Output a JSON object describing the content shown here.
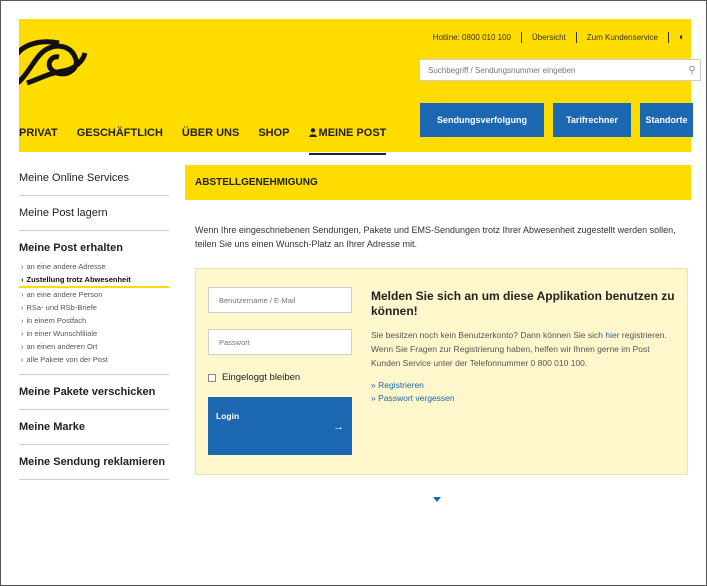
{
  "header": {
    "utility": {
      "hotline": "Hotline: 0800 010 100",
      "overview": "Übersicht",
      "customer_service": "Zum Kundenservice"
    },
    "search": {
      "placeholder": "Suchbegriff / Sendungsnummer eingeben",
      "icon": "search-icon"
    },
    "nav": [
      {
        "label": "PRIVAT"
      },
      {
        "label": "GESCHÄFTLICH"
      },
      {
        "label": "ÜBER UNS"
      },
      {
        "label": "SHOP"
      },
      {
        "label": "MEINE POST",
        "active": true,
        "icon": "user-icon"
      }
    ],
    "buttons": [
      "Sendungsverfolgung",
      "Tarifrechner",
      "Standorte"
    ]
  },
  "sidebar": {
    "sections": [
      {
        "label": "Meine Online Services"
      },
      {
        "label": "Meine Post lagern"
      },
      {
        "label": "Meine Post erhalten",
        "bold": true
      }
    ],
    "subitems": [
      {
        "label": "an eine andere Adresse"
      },
      {
        "label": "Zustellung trotz Abwesenheit",
        "active": true
      },
      {
        "label": "an eine andere Person"
      },
      {
        "label": "RSa- und RSb-Briefe"
      },
      {
        "label": "in einem Postfach"
      },
      {
        "label": "in einer Wunschfiliale"
      },
      {
        "label": "an einen anderen Ort"
      },
      {
        "label": "alle Pakete von der Post"
      }
    ],
    "bottom_sections": [
      {
        "label": "Meine Pakete verschicken"
      },
      {
        "label": "Meine Marke"
      },
      {
        "label": "Meine Sendung reklamieren"
      }
    ]
  },
  "main": {
    "title": "ABSTELLGENEHMIGUNG",
    "intro": "Wenn Ihre eingeschriebenen Sendungen, Pakete und EMS-Sendungen trotz Ihrer Abwesenheit zugestellt werden sollen, teilen Sie uns einen Wunsch-Platz an Ihrer Adresse mit.",
    "login": {
      "username_placeholder": "Benutzername / E-Mail",
      "password_placeholder": "Passwort",
      "remember_label": "Eingeloggt bleiben",
      "login_label": "Login",
      "heading": "Melden Sie sich an um diese Applikation benutzen zu können!",
      "desc_before": "Sie besitzen noch kein Benutzerkonto? Dann können Sie sich ",
      "desc_link": "hier",
      "desc_after": " registrieren. Wenn Sie Fragen zur Registrierung haben, helfen wir Ihnen gerne im Post Kunden Service unter der Telefonnummer 0 800 010 100.",
      "links": [
        "» Registrieren",
        "» Passwort vergessen"
      ]
    }
  },
  "colors": {
    "brand_yellow": "#ffdc00",
    "brand_blue": "#1b67b2"
  }
}
